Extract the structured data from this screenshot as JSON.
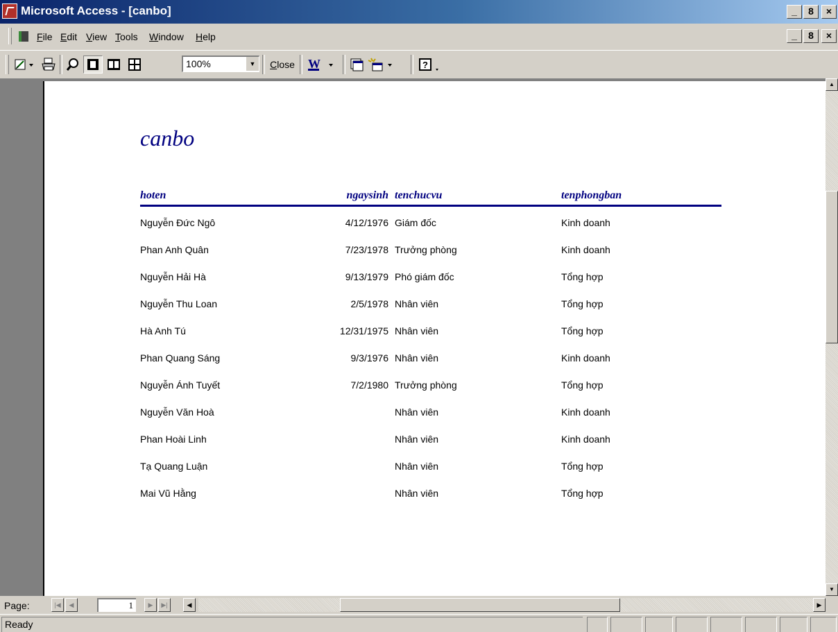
{
  "window": {
    "title": "Microsoft Access - [canbo]",
    "controls": [
      "_",
      "8",
      "×"
    ],
    "doc_controls": [
      "_",
      "8",
      "×"
    ]
  },
  "menu": {
    "items": [
      {
        "label": "File",
        "accel": "F",
        "rest": "ile"
      },
      {
        "label": "Edit",
        "accel": "E",
        "rest": "dit"
      },
      {
        "label": "View",
        "accel": "V",
        "rest": "iew"
      },
      {
        "label": "Tools",
        "accel": "T",
        "rest": "ools"
      },
      {
        "label": "Window",
        "accel": "W",
        "rest": "indow"
      },
      {
        "label": "Help",
        "accel": "H",
        "rest": "elp"
      }
    ]
  },
  "toolbar": {
    "zoom_value": "100%",
    "close_accel": "C",
    "close_rest": "lose",
    "icons": {
      "view": "design-view-icon",
      "print": "printer-icon",
      "zoom": "magnifier-icon",
      "one_page": "one-page-icon",
      "two_pages": "two-pages-icon",
      "multiple_pages": "multiple-pages-icon",
      "office_links": "word-icon",
      "database_window": "database-window-icon",
      "new_object": "new-object-icon",
      "help": "help-icon"
    }
  },
  "report": {
    "title": "canbo",
    "columns": {
      "hoten": "hoten",
      "ngaysinh": "ngaysinh",
      "tenchucvu": "tenchucvu",
      "tenphongban": "tenphongban"
    },
    "rows": [
      {
        "hoten": "Nguyễn Đức Ngô",
        "ngaysinh": "4/12/1976",
        "tenchucvu": "Giám đốc",
        "tenphongban": "Kinh doanh"
      },
      {
        "hoten": "Phan Anh Quân",
        "ngaysinh": "7/23/1978",
        "tenchucvu": "Trưởng phòng",
        "tenphongban": "Kinh doanh"
      },
      {
        "hoten": "Nguyễn Hải Hà",
        "ngaysinh": "9/13/1979",
        "tenchucvu": "Phó giám đốc",
        "tenphongban": "Tổng hợp"
      },
      {
        "hoten": "Nguyễn Thu Loan",
        "ngaysinh": "2/5/1978",
        "tenchucvu": "Nhân viên",
        "tenphongban": "Tổng hợp"
      },
      {
        "hoten": "Hà Anh Tú",
        "ngaysinh": "12/31/1975",
        "tenchucvu": "Nhân viên",
        "tenphongban": "Tổng hợp"
      },
      {
        "hoten": "Phan Quang Sáng",
        "ngaysinh": "9/3/1976",
        "tenchucvu": "Nhân viên",
        "tenphongban": "Kinh doanh"
      },
      {
        "hoten": "Nguyễn Ánh Tuyết",
        "ngaysinh": "7/2/1980",
        "tenchucvu": "Trưởng phòng",
        "tenphongban": "Tổng hợp"
      },
      {
        "hoten": "Nguyễn Văn Hoà",
        "ngaysinh": "",
        "tenchucvu": "Nhân viên",
        "tenphongban": "Kinh doanh"
      },
      {
        "hoten": "Phan Hoài Linh",
        "ngaysinh": "",
        "tenchucvu": "Nhân viên",
        "tenphongban": "Kinh doanh"
      },
      {
        "hoten": "Tạ Quang Luận",
        "ngaysinh": "",
        "tenchucvu": "Nhân viên",
        "tenphongban": "Tổng hợp"
      },
      {
        "hoten": "Mai Vũ Hằng",
        "ngaysinh": "",
        "tenchucvu": "Nhân viên",
        "tenphongban": "Tổng hợp"
      }
    ]
  },
  "navigation": {
    "label": "Page:",
    "current_page": "1"
  },
  "status": {
    "text": "Ready"
  },
  "colors": {
    "title_bar": "#0a246a",
    "report_heading": "#000080",
    "chrome": "#d4d0c8"
  }
}
